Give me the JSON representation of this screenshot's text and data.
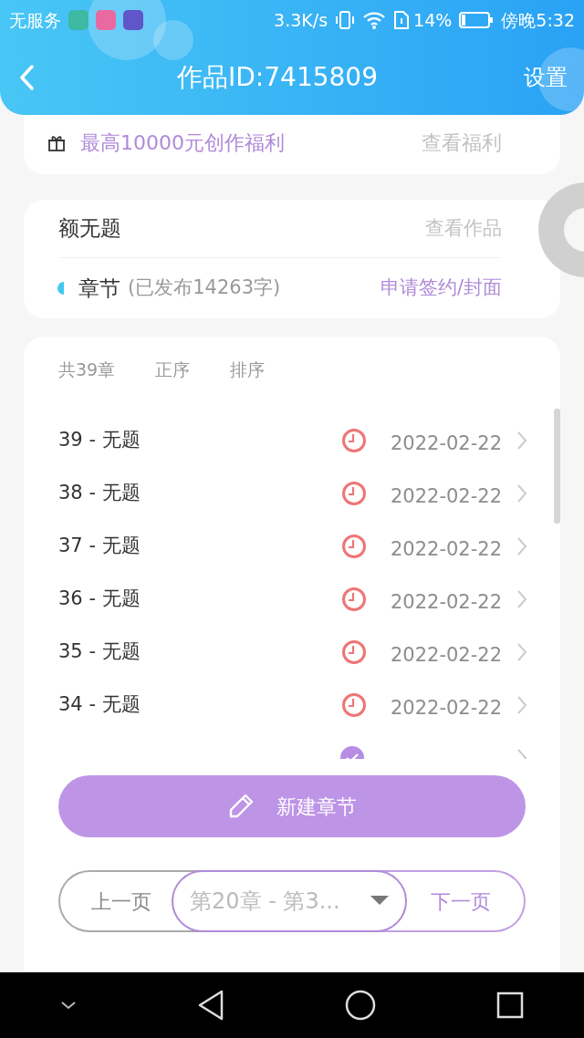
{
  "status_bar": {
    "carrier": "无服务",
    "speed": "3.3K/s",
    "battery": "14%",
    "time": "傍晚5:32"
  },
  "header": {
    "title": "作品ID:7415809",
    "action": "设置"
  },
  "benefit": {
    "text": "最高10000元创作福利",
    "link": "查看福利"
  },
  "work": {
    "title": "额无题",
    "link": "查看作品",
    "section": "章节",
    "published": "(已发布14263字)",
    "action": "申请签约/封面"
  },
  "chapters": {
    "count": "共39章",
    "sort_order": "正序",
    "sort": "排序",
    "items": [
      {
        "title": "39 - 无题",
        "kind": "clock",
        "date": "2022-02-22"
      },
      {
        "title": "38 - 无题",
        "kind": "clock",
        "date": "2022-02-22"
      },
      {
        "title": "37 - 无题",
        "kind": "clock",
        "date": "2022-02-22"
      },
      {
        "title": "36 - 无题",
        "kind": "clock",
        "date": "2022-02-22"
      },
      {
        "title": "35 - 无题",
        "kind": "clock",
        "date": "2022-02-22"
      },
      {
        "title": "34 - 无题",
        "kind": "clock",
        "date": "2022-02-22"
      },
      {
        "kind": "check"
      }
    ]
  },
  "new_chapter": "新建章节",
  "pager": {
    "prev": "上一页",
    "range": "第20章 - 第3...",
    "next": "下一页"
  }
}
